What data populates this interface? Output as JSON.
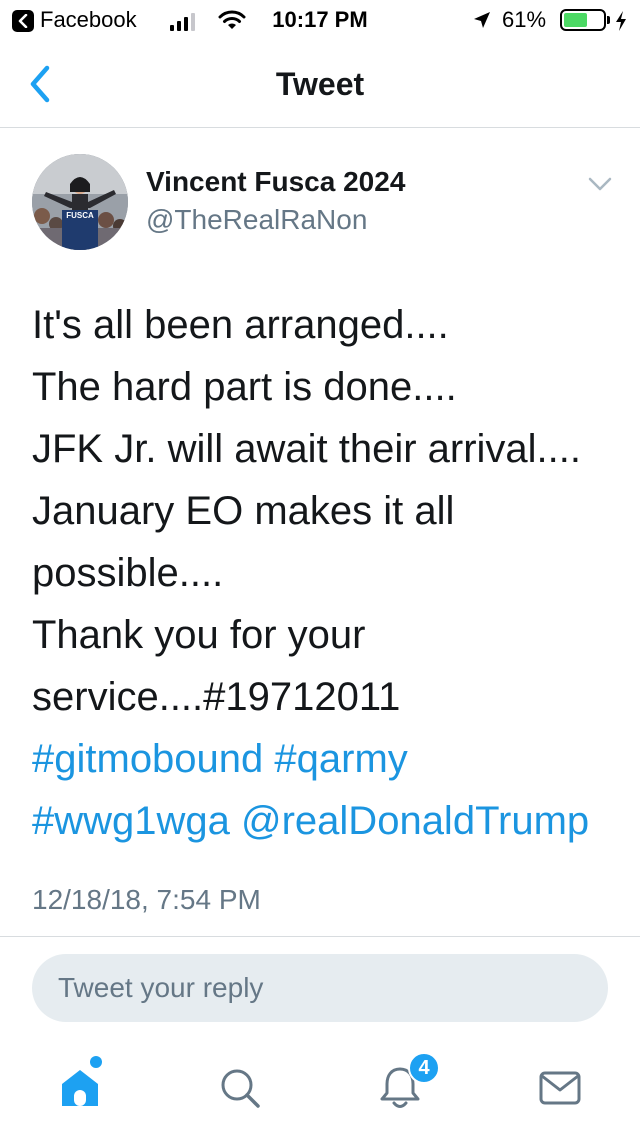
{
  "status_bar": {
    "back_app": "Facebook",
    "time": "10:17 PM",
    "battery_percent": "61%",
    "battery_level": 0.61,
    "signal_bars": 3
  },
  "nav": {
    "title": "Tweet"
  },
  "tweet": {
    "avatar_caption": "FUSCA",
    "display_name": "Vincent Fusca 2024",
    "handle": "@TheRealRaNon",
    "body_lines": [
      "It's all been arranged....",
      "The hard part is done....",
      "JFK Jr. will await their arrival....",
      "January EO makes it all",
      "possible....",
      "Thank you for your",
      "service....#19712011"
    ],
    "hashtag_line_1": "#gitmobound #qarmy",
    "hashtag_line_2": "#wwg1wga @realDonaldTrump",
    "timestamp": "12/18/18, 7:54 PM"
  },
  "reply": {
    "placeholder": "Tweet your reply"
  },
  "tab_bar": {
    "notifications_badge": "4",
    "icons": [
      "home-icon",
      "search-icon",
      "notifications-icon",
      "messages-icon"
    ]
  },
  "colors": {
    "accent": "#1da1f2",
    "link": "#1b95e0",
    "secondary_text": "#657786",
    "battery_green": "#4cd964"
  }
}
